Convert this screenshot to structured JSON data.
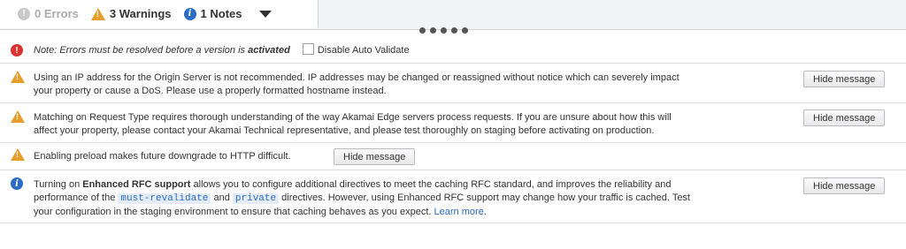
{
  "tabs": {
    "errors": {
      "count": "0",
      "label": "Errors"
    },
    "warnings": {
      "count": "3",
      "label": "Warnings"
    },
    "notes": {
      "count": "1",
      "label": "Notes"
    }
  },
  "note_row": {
    "prefix": "Note: Errors must be resolved before a version is ",
    "emphasis": "activated",
    "checkbox_label": "Disable Auto Validate"
  },
  "messages": [
    {
      "line1": "Using an IP address for the Origin Server is not recommended. IP addresses may be changed or reassigned without notice which can severely impact",
      "line2": "your property or cause a DoS. Please use a properly formatted hostname instead.",
      "button": "Hide message"
    },
    {
      "line1": "Matching on Request Type requires thorough understanding of the way Akamai Edge servers process requests. If you are unsure about how this will",
      "line2": "affect your property, please contact your Akamai Technical representative, and please test thoroughly on staging before activating on production.",
      "button": "Hide message"
    },
    {
      "line1": "Enabling preload makes future downgrade to HTTP difficult.",
      "button": "Hide message"
    }
  ],
  "rfc": {
    "l1_pre": "Turning on ",
    "l1_bold": "Enhanced RFC support",
    "l1_post": " allows you to configure additional directives to meet the caching RFC standard, and improves the reliability and",
    "l2_pre": "performance of the ",
    "code1": "must-revalidate",
    "l2_mid": " and ",
    "code2": "private",
    "l2_post": " directives. However, using Enhanced RFC support may change how your traffic is cached. Test",
    "l3": "your configuration in the staging environment to ensure that caching behaves as you expect. ",
    "link": "Learn more",
    "l3_end": ".",
    "button": "Hide message"
  }
}
